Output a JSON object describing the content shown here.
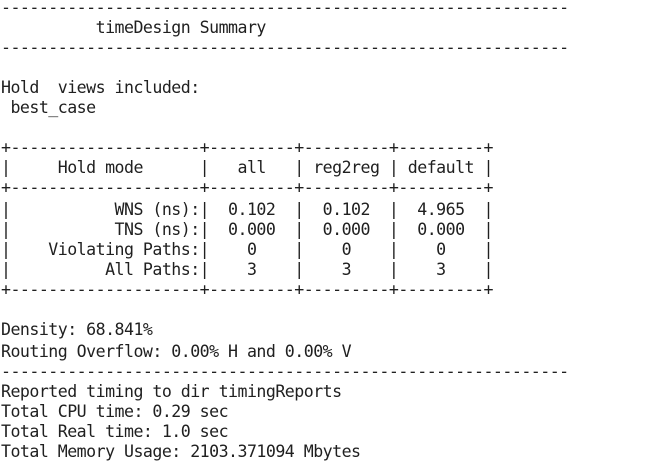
{
  "lines": [
    "------------------------------------------------------------",
    "          timeDesign Summary",
    "------------------------------------------------------------",
    "",
    "Hold  views included:",
    " best_case",
    "",
    "+--------------------+---------+---------+---------+",
    "|     Hold mode      |   all   | reg2reg | default |",
    "+--------------------+---------+---------+---------+",
    "|           WNS (ns):|  0.102  |  0.102  |  4.965  |",
    "|           TNS (ns):|  0.000  |  0.000  |  0.000  |",
    "|    Violating Paths:|    0    |    0    |    0    |",
    "|          All Paths:|    3    |    3    |    3    |",
    "+--------------------+---------+---------+---------+",
    "",
    "Density: 68.841%",
    "Routing Overflow: 0.00% H and 0.00% V",
    "------------------------------------------------------------",
    "Reported timing to dir timingReports",
    "Total CPU time: 0.29 sec",
    "Total Real time: 1.0 sec",
    "Total Memory Usage: 2103.371094 Mbytes"
  ]
}
